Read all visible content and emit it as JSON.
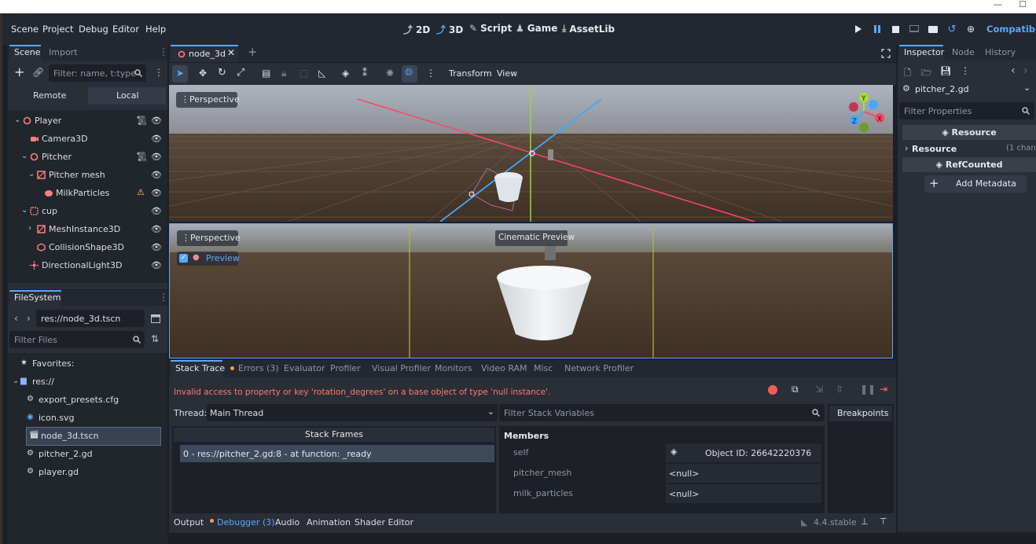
{
  "menus": [
    "Scene",
    "Project",
    "Debug",
    "Editor",
    "Help"
  ],
  "workspaces": [
    "2D",
    "3D",
    "Script",
    "Game",
    "AssetLib"
  ],
  "renderer_label": "Compatibili",
  "scene_dock": {
    "tabs": [
      "Scene",
      "Import"
    ],
    "filter_placeholder": "Filter: name, t:type, g:",
    "remote_label": "Remote",
    "local_label": "Local",
    "tree": [
      {
        "label": "Player",
        "depth": 0,
        "icon": "node3d-icon",
        "script": true,
        "warning": false,
        "arrow": "down"
      },
      {
        "label": "Camera3D",
        "depth": 1,
        "icon": "camera-icon",
        "script": false,
        "warning": false,
        "arrow": ""
      },
      {
        "label": "Pitcher",
        "depth": 1,
        "icon": "node3d-icon",
        "script": true,
        "warning": false,
        "arrow": "down"
      },
      {
        "label": "Pitcher mesh",
        "depth": 2,
        "icon": "mesh-icon",
        "script": false,
        "warning": false,
        "arrow": "down"
      },
      {
        "label": "MilkParticles",
        "depth": 3,
        "icon": "particles-icon",
        "script": false,
        "warning": true,
        "arrow": ""
      },
      {
        "label": "cup",
        "depth": 1,
        "icon": "scene-instance-icon",
        "script": false,
        "warning": false,
        "arrow": "down"
      },
      {
        "label": "MeshInstance3D",
        "depth": 2,
        "icon": "mesh-icon",
        "script": false,
        "warning": false,
        "arrow": "right"
      },
      {
        "label": "CollisionShape3D",
        "depth": 2,
        "icon": "collision-icon",
        "script": false,
        "warning": false,
        "arrow": ""
      },
      {
        "label": "DirectionalLight3D",
        "depth": 1,
        "icon": "light-icon",
        "script": false,
        "warning": false,
        "arrow": ""
      }
    ]
  },
  "filesystem": {
    "title": "FileSystem",
    "path": "res://node_3d.tscn",
    "filter_placeholder": "Filter Files",
    "items": [
      {
        "label": "Favorites:",
        "depth": 0,
        "icon": "star-icon",
        "selected": false
      },
      {
        "label": "res://",
        "depth": 0,
        "icon": "folder-icon",
        "selected": false
      },
      {
        "label": "export_presets.cfg",
        "depth": 1,
        "icon": "gear-icon",
        "selected": false
      },
      {
        "label": "icon.svg",
        "depth": 1,
        "icon": "image-icon",
        "selected": false
      },
      {
        "label": "node_3d.tscn",
        "depth": 1,
        "icon": "scene-file-icon",
        "selected": true
      },
      {
        "label": "pitcher_2.gd",
        "depth": 1,
        "icon": "gear-icon",
        "selected": false
      },
      {
        "label": "player.gd",
        "depth": 1,
        "icon": "gear-icon",
        "selected": false
      }
    ]
  },
  "scene_tab": {
    "label": "node_3d"
  },
  "viewport_toolbar": {
    "transform_label": "Transform",
    "view_label": "View"
  },
  "viewport_top": {
    "label": "Perspective"
  },
  "viewport_bottom": {
    "label": "Perspective",
    "preview_label": "Preview",
    "cinematic_label": "Cinematic Preview"
  },
  "gizmo_axes": [
    "Y",
    "X",
    "Z"
  ],
  "debugger": {
    "tabs": [
      "Stack Trace",
      "Errors (3)",
      "Evaluator",
      "Profiler",
      "Visual Profiler",
      "Monitors",
      "Video RAM",
      "Misc",
      "Network Profiler"
    ],
    "error_message": "Invalid access to property or key 'rotation_degrees' on a base object of type 'null instance'.",
    "thread_label": "Thread:",
    "thread_value": "Main Thread",
    "filter_placeholder": "Filter Stack Variables",
    "stack_header": "Stack Frames",
    "stack_frames": [
      "0 - res://pitcher_2.gd:8 - at function: _ready"
    ],
    "members_header": "Members",
    "members": [
      {
        "name": "self",
        "value": "Object ID: 26642220376"
      },
      {
        "name": "pitcher_mesh",
        "value": "<null>"
      },
      {
        "name": "milk_particles",
        "value": "<null>"
      }
    ],
    "breakpoints_label": "Breakpoints"
  },
  "bottom_tabs": [
    "Output",
    "Debugger (3)",
    "Audio",
    "Animation",
    "Shader Editor"
  ],
  "version": "4.4.stable",
  "inspector": {
    "tabs": [
      "Inspector",
      "Node",
      "History"
    ],
    "resource_name": "pitcher_2.gd",
    "filter_placeholder": "Filter Properties",
    "section_resource": "Resource",
    "resource_row_label": "Resource",
    "resource_row_value": "(1 chan",
    "section_refcounted": "RefCounted",
    "add_metadata_label": "Add Metadata"
  },
  "colors": {
    "accent": "#5aa7ff",
    "error_text": "#ff7a6b",
    "warning": "#ffdd44",
    "node3d": "#fc7f7f",
    "x_axis": "#ff4566",
    "y_axis": "#a6e22e",
    "z_axis": "#3ea8ff"
  }
}
